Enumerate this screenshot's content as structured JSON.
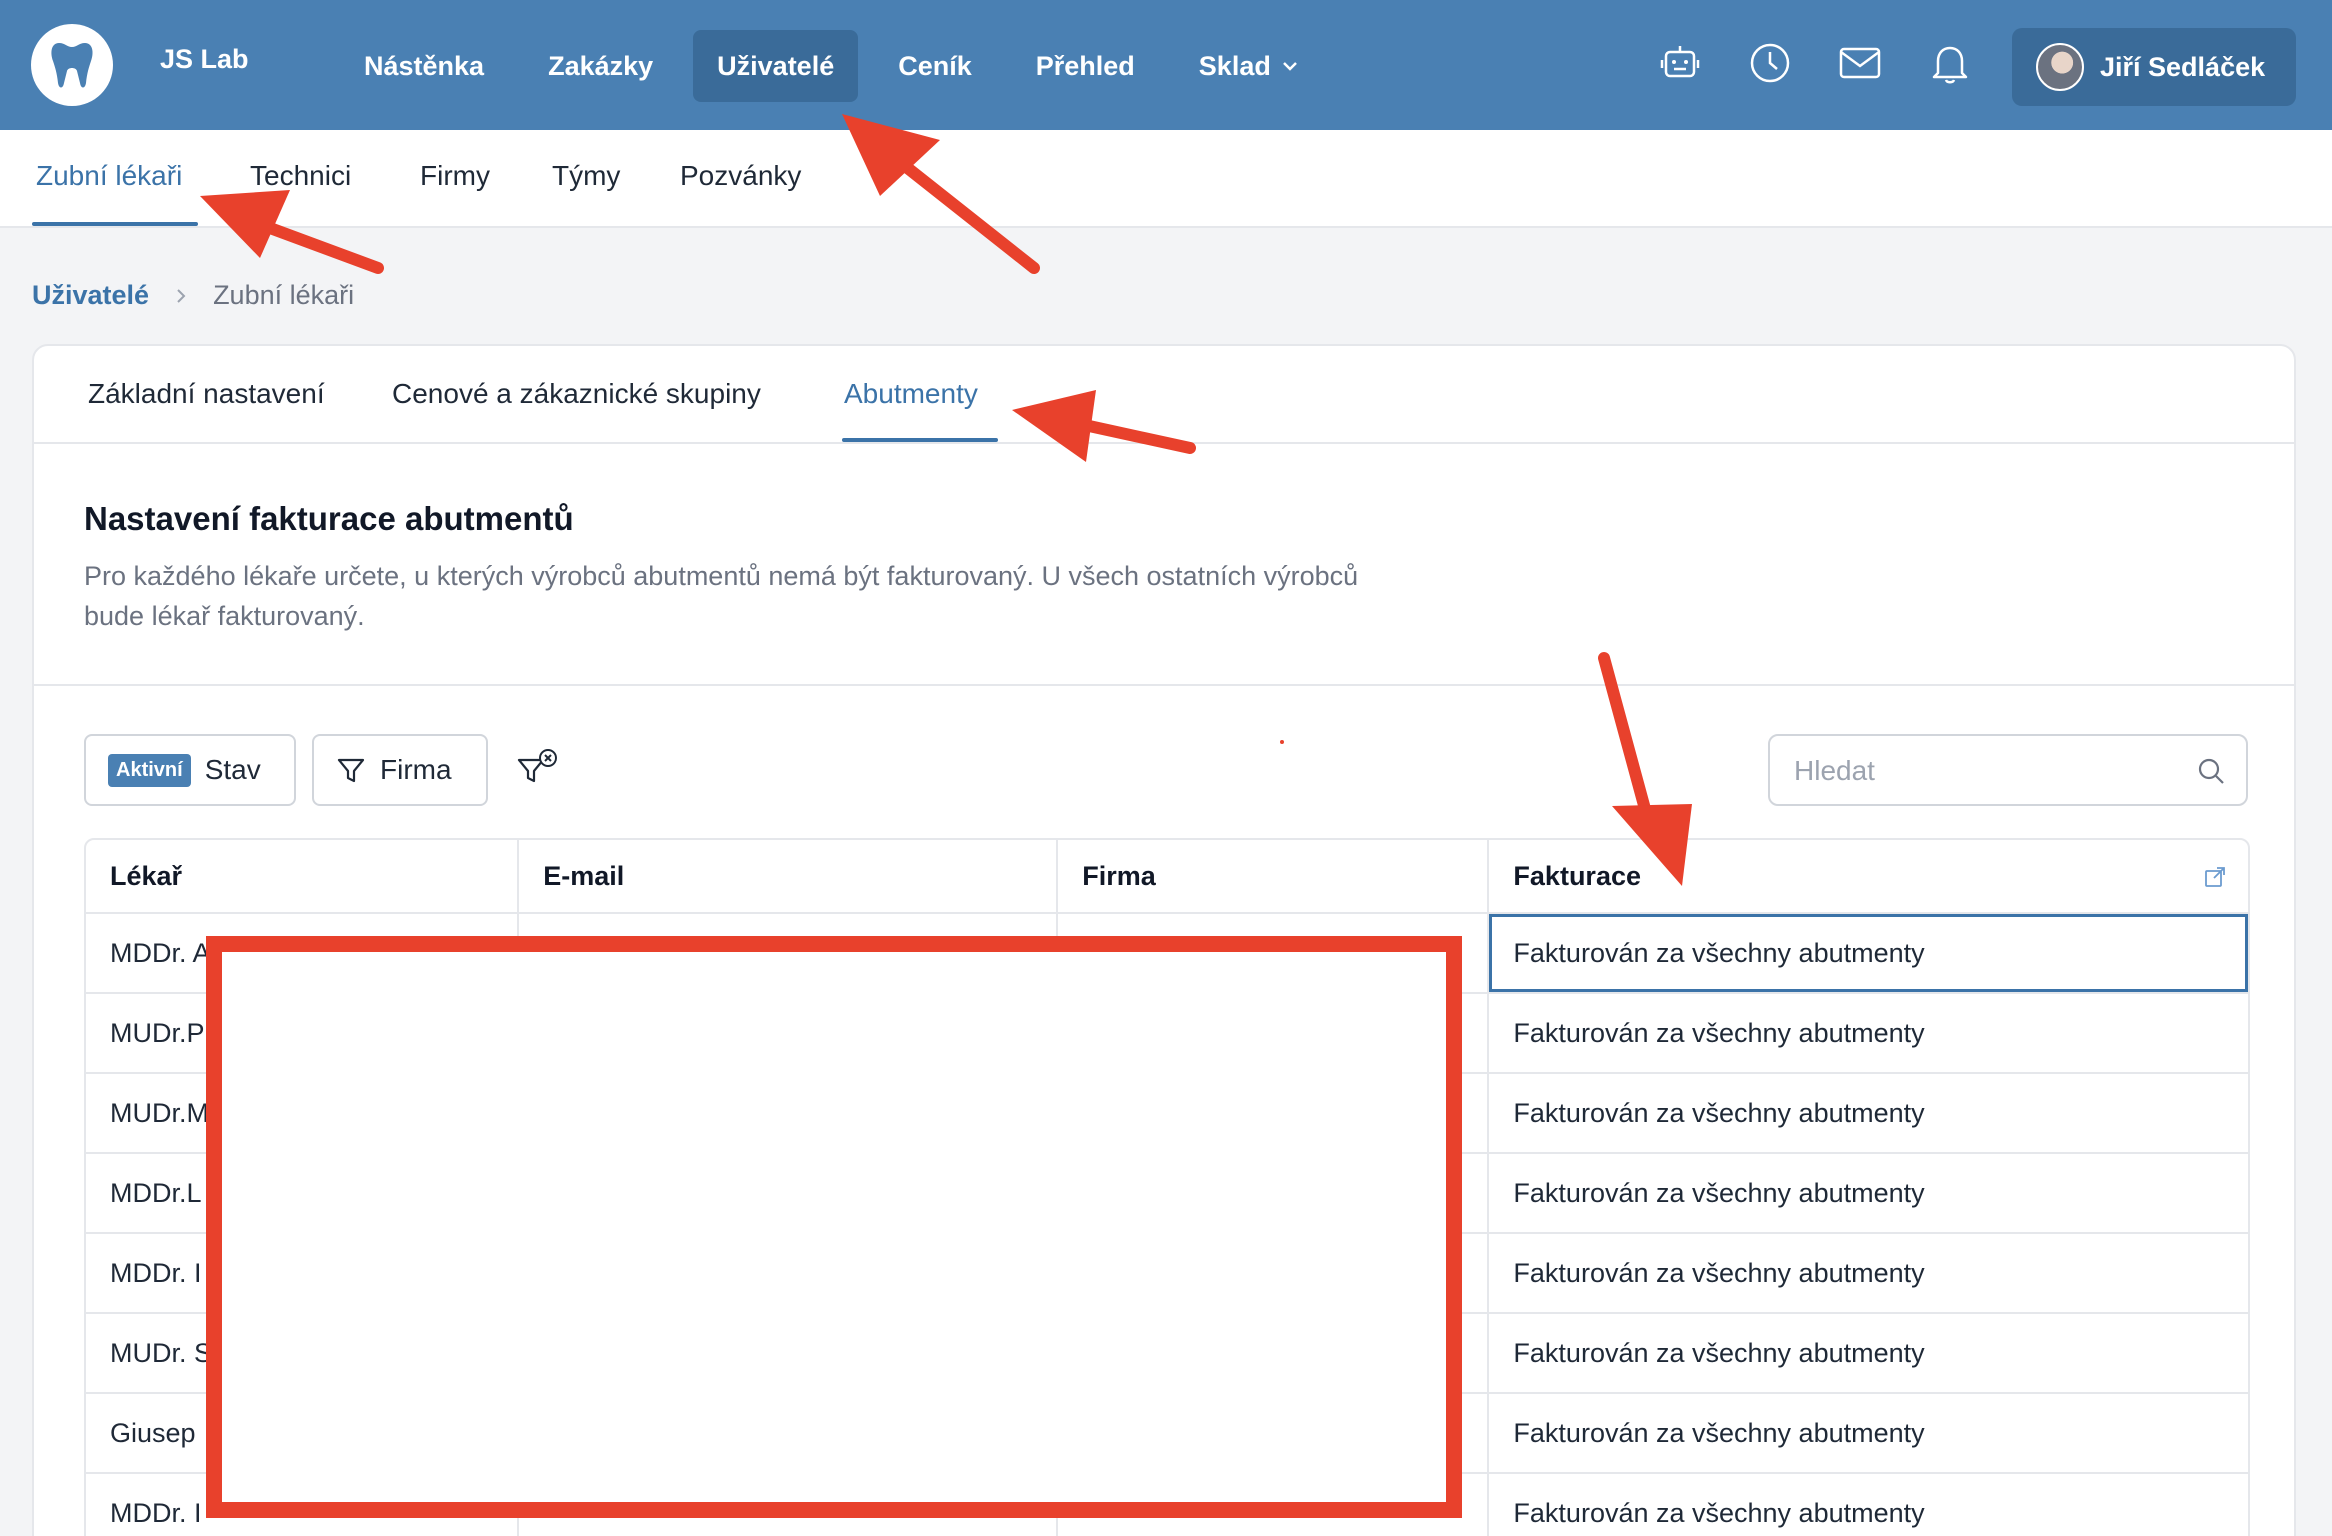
{
  "brand": {
    "name": "JS Lab",
    "logo_icon": "tooth-icon"
  },
  "nav": {
    "items": [
      {
        "label": "Nástěnka"
      },
      {
        "label": "Zakázky"
      },
      {
        "label": "Uživatelé",
        "active": true
      },
      {
        "label": "Ceník"
      },
      {
        "label": "Přehled"
      },
      {
        "label": "Sklad",
        "has_dropdown": true
      }
    ]
  },
  "top_icons": [
    "robot-icon",
    "clock-icon",
    "mail-icon",
    "bell-icon"
  ],
  "user": {
    "name": "Jiří Sedláček"
  },
  "subnav": {
    "items": [
      {
        "label": "Zubní lékaři",
        "active": true
      },
      {
        "label": "Technici"
      },
      {
        "label": "Firmy"
      },
      {
        "label": "Týmy"
      },
      {
        "label": "Pozvánky"
      }
    ]
  },
  "breadcrumb": {
    "parent": "Uživatelé",
    "current": "Zubní lékaři"
  },
  "card": {
    "tabs": [
      {
        "label": "Základní nastavení"
      },
      {
        "label": "Cenové a zákaznické skupiny"
      },
      {
        "label": "Abutmenty",
        "active": true
      }
    ],
    "title": "Nastavení fakturace abutmentů",
    "description": "Pro každého lékaře určete, u kterých výrobců abutmentů nemá být fakturovaný. U všech ostatních výrobců bude lékař fakturovaný."
  },
  "filters": {
    "status_badge": "Aktivní",
    "status_label": "Stav",
    "company_label": "Firma",
    "search_placeholder": "Hledat"
  },
  "table": {
    "headers": {
      "doctor": "Lékař",
      "email": "E-mail",
      "company": "Firma",
      "billing": "Fakturace"
    },
    "rows": [
      {
        "doctor": "MDDr. A",
        "billing": "Fakturován za všechny abutmenty"
      },
      {
        "doctor": "MUDr.P",
        "billing": "Fakturován za všechny abutmenty"
      },
      {
        "doctor": "MUDr.M",
        "billing": "Fakturován za všechny abutmenty"
      },
      {
        "doctor": "MDDr.L",
        "billing": "Fakturován za všechny abutmenty"
      },
      {
        "doctor": "MDDr. I",
        "billing": "Fakturován za všechny abutmenty"
      },
      {
        "doctor": "MUDr. S",
        "billing": "Fakturován za všechny abutmenty"
      },
      {
        "doctor": "Giusep",
        "billing": "Fakturován za všechny abutmenty"
      },
      {
        "doctor": "MDDr. I",
        "billing": "Fakturován za všechny abutmenty"
      }
    ]
  },
  "annotation_color": "#e8412c",
  "accent_color": "#4a80b3"
}
